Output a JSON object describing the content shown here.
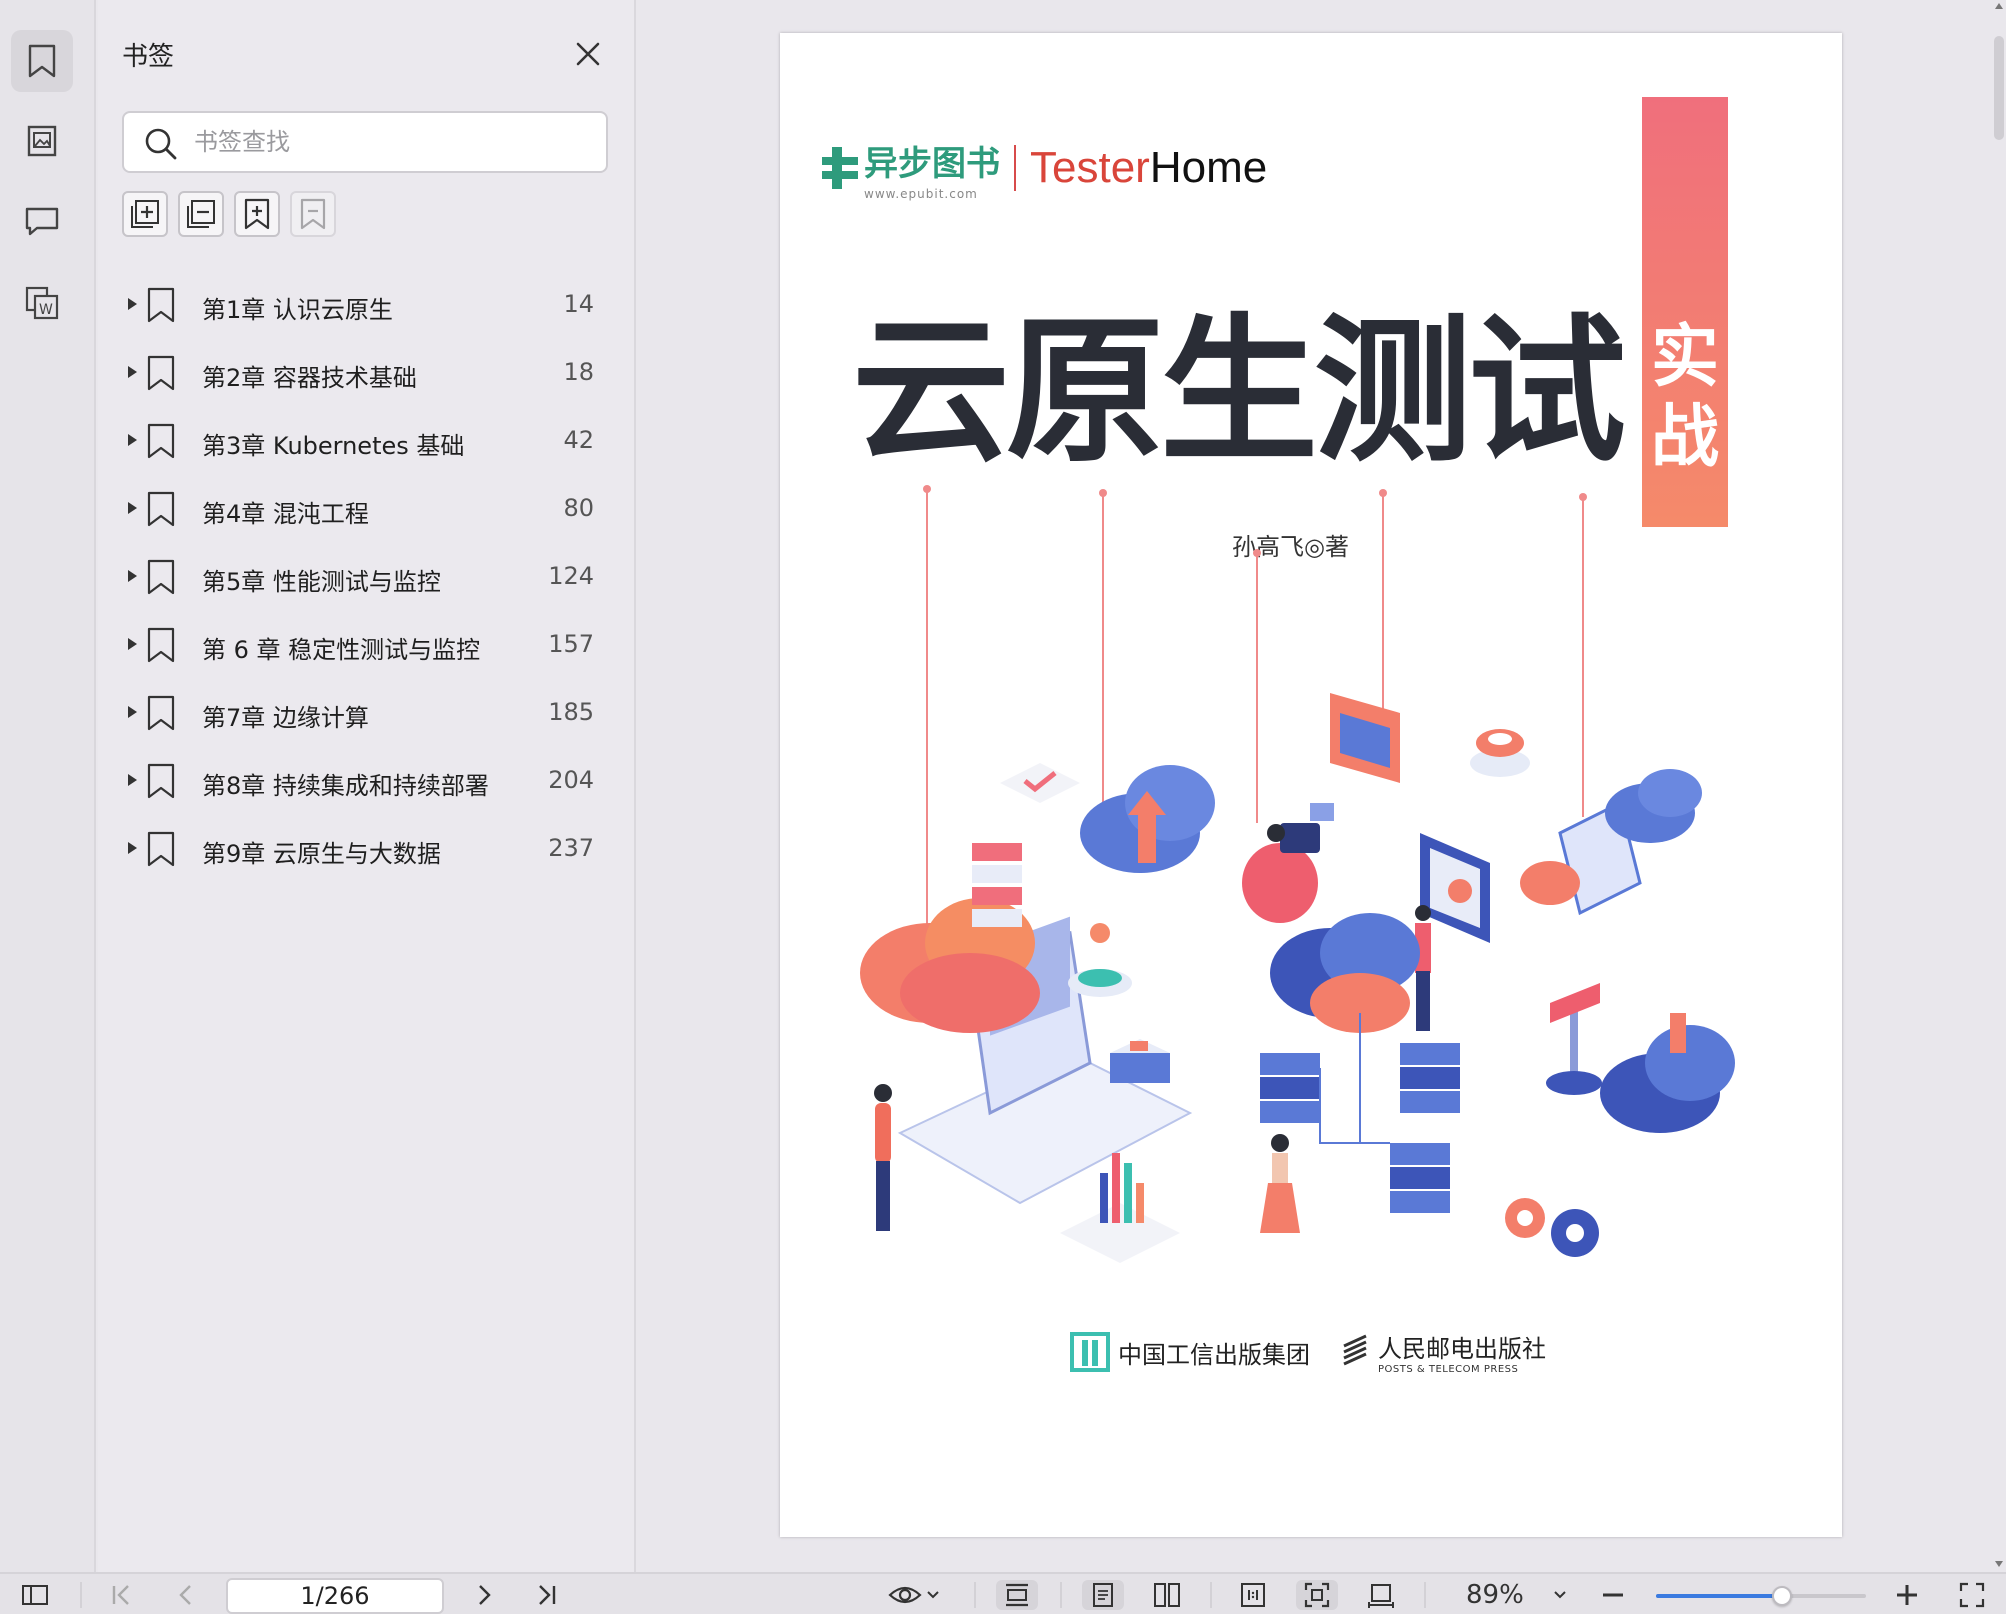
{
  "bookmarks_panel": {
    "title": "书签",
    "search_placeholder": "书签查找",
    "items": [
      {
        "label": "第1章 认识云原生",
        "page": "14"
      },
      {
        "label": "第2章 容器技术基础",
        "page": "18"
      },
      {
        "label": "第3章 Kubernetes 基础",
        "page": "42"
      },
      {
        "label": "第4章 混沌工程",
        "page": "80"
      },
      {
        "label": "第5章 性能测试与监控",
        "page": "124"
      },
      {
        "label": "第 6 章 稳定性测试与监控",
        "page": "157"
      },
      {
        "label": "第7章 边缘计算",
        "page": "185"
      },
      {
        "label": "第8章 持续集成和持续部署",
        "page": "204"
      },
      {
        "label": "第9章 云原生与大数据",
        "page": "237"
      }
    ]
  },
  "cover": {
    "logo_epubit": "异步图书",
    "logo_epubit_url": "www.epubit.com",
    "logo_testerhome_a": "Tester",
    "logo_testerhome_b": "Home",
    "main_title": "云原生测试",
    "sub_title": "实战",
    "author": "孙高飞◎著",
    "publisher1": "中国工信出版集团",
    "publisher2_cn": "人民邮电出版社",
    "publisher2_en": "POSTS & TELECOM PRESS"
  },
  "statusbar": {
    "page_indicator": "1/266",
    "zoom": "89%",
    "zoom_level": 0.6
  },
  "colors": {
    "accent": "#3a7ae0",
    "cover_bar_top": "#f06f7c",
    "cover_bar_bottom": "#f58a6a",
    "title_dark": "#2a2d36",
    "teal": "#3cbfb0",
    "coral": "#f07070"
  }
}
